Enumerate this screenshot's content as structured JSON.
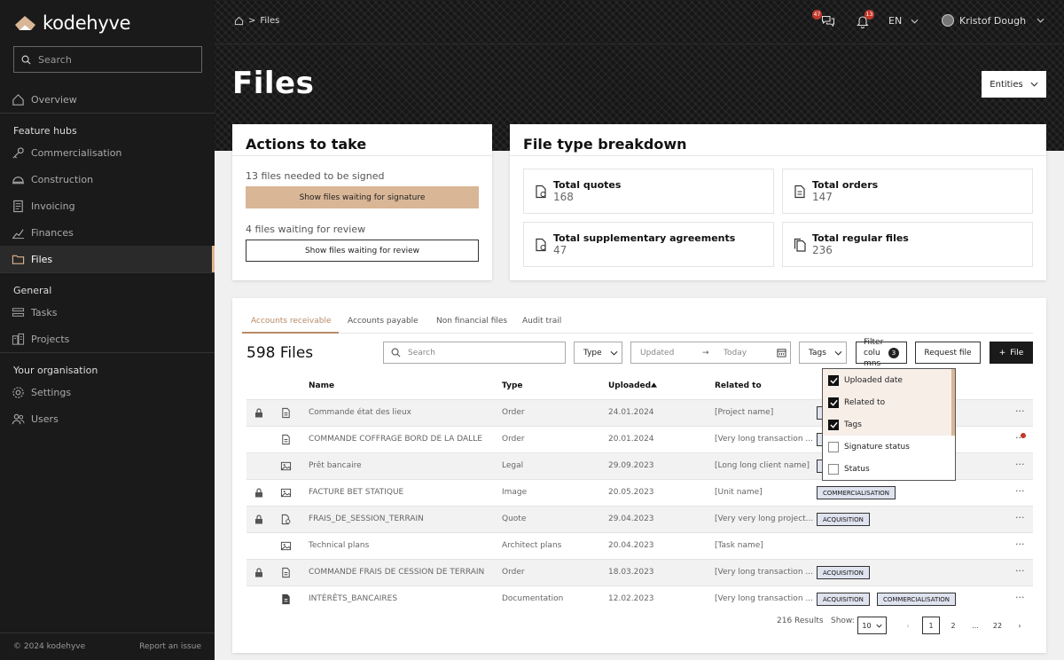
{
  "app": {
    "logo_text": "kodehyve"
  },
  "sidebar": {
    "search_placeholder": "Search",
    "overview": "Overview",
    "section_feature": "Feature hubs",
    "items_feature": [
      "Commercialisation",
      "Construction",
      "Invoicing",
      "Finances",
      "Files"
    ],
    "section_general": "General",
    "items_general": [
      "Tasks",
      "Projects"
    ],
    "section_org": "Your organisation",
    "items_org": [
      "Settings",
      "Users"
    ],
    "active": "Files",
    "copyright": "© 2024 kodehyve",
    "report": "Report an issue"
  },
  "topbar": {
    "breadcrumb": "Files",
    "chat_badge": "47",
    "bell_badge": "13",
    "language": "EN",
    "user_name": "Kristof Dough"
  },
  "page": {
    "title": "Files",
    "entities_label": "Entities"
  },
  "actions": {
    "title": "Actions to take",
    "sign_text": "13 files needed to be signed",
    "sign_button": "Show files waiting for signature",
    "review_text": "4 files waiting for review",
    "review_button": "Show files waiting for review"
  },
  "breakdown": {
    "title": "File type breakdown",
    "stats": [
      {
        "label": "Total quotes",
        "value": "168"
      },
      {
        "label": "Total orders",
        "value": "147"
      },
      {
        "label": "Total supplementary agreements",
        "value": "47"
      },
      {
        "label": "Total regular files",
        "value": "236"
      }
    ]
  },
  "tabs": [
    "Accounts receivable",
    "Accounts payable",
    "Non financial files",
    "Audit trail"
  ],
  "toolbar": {
    "files_count": "598 Files",
    "search_placeholder": "Search",
    "type_label": "Type",
    "date_from": "Updated",
    "date_to": "Today",
    "tags_label": "Tags",
    "filter_columns_label": "Filter colu mns",
    "filter_columns_count": "3",
    "request_file": "Request file",
    "add_file": "File"
  },
  "table": {
    "headers": [
      "Name",
      "Type",
      "Uploaded",
      "Related to"
    ],
    "rows": [
      {
        "name": "Commande état des lieux",
        "type": "Order",
        "uploaded": "24.01.2024",
        "related": "[Project name]",
        "locked": true,
        "icon": "document-icon",
        "tags": [
          "COMMERCIALISATION"
        ]
      },
      {
        "name": "COMMANDE COFFRAGE BORD DE LA DALLE",
        "type": "Order",
        "uploaded": "20.01.2024",
        "related": "[Very long transaction ...",
        "locked": false,
        "icon": "document-icon",
        "tags": [
          "ACQUISITION"
        ]
      },
      {
        "name": "Prêt bancaire",
        "type": "Legal",
        "uploaded": "29.09.2023",
        "related": "[Long long client name]",
        "locked": false,
        "icon": "image-icon",
        "tags": [
          "ACQUISITION"
        ]
      },
      {
        "name": "FACTURE BET STATIQUE",
        "type": "Image",
        "uploaded": "20.05.2023",
        "related": "[Unit name]",
        "locked": true,
        "icon": "image-icon",
        "tags": [
          "COMMERCIALISATION"
        ]
      },
      {
        "name": "FRAIS_DE_SESSION_TERRAIN",
        "type": "Quote",
        "uploaded": "29.04.2023",
        "related": "[Very very long project...",
        "locked": true,
        "icon": "quote-icon",
        "tags": [
          "ACQUISITION"
        ]
      },
      {
        "name": "Technical plans",
        "type": "Architect plans",
        "uploaded": "20.04.2023",
        "related": "[Task name]",
        "locked": false,
        "icon": "image-icon",
        "tags": []
      },
      {
        "name": "COMMANDE FRAIS DE CESSION DE TERRAIN",
        "type": "Order",
        "uploaded": "18.03.2023",
        "related": "[Very long transaction ...",
        "locked": true,
        "icon": "document-icon",
        "tags": [
          "ACQUISITION"
        ]
      },
      {
        "name": "INTÉRÊTS_BANCAIRES",
        "type": "Documentation",
        "uploaded": "12.02.2023",
        "related": "[Very long transaction ...",
        "locked": false,
        "icon": "filled-document-icon",
        "tags": [
          "ACQUISITION",
          "COMMERCIALISATION"
        ]
      }
    ]
  },
  "column_filter": {
    "options": [
      {
        "label": "Uploaded date",
        "checked": true
      },
      {
        "label": "Related to",
        "checked": true
      },
      {
        "label": "Tags",
        "checked": true
      },
      {
        "label": "Signature status",
        "checked": false
      },
      {
        "label": "Status",
        "checked": false
      }
    ]
  },
  "pagination": {
    "results": "216 Results",
    "show_label": "Show:",
    "page_size": "10",
    "pages": [
      "1",
      "2",
      "...",
      "22"
    ],
    "current_page": "1"
  },
  "colors": {
    "accent": "#b98a64",
    "button_fill": "#d9b696",
    "sidebar_bg": "#1a1a1a",
    "tag_bg": "#dfe3ef",
    "alert": "#c0392b"
  }
}
